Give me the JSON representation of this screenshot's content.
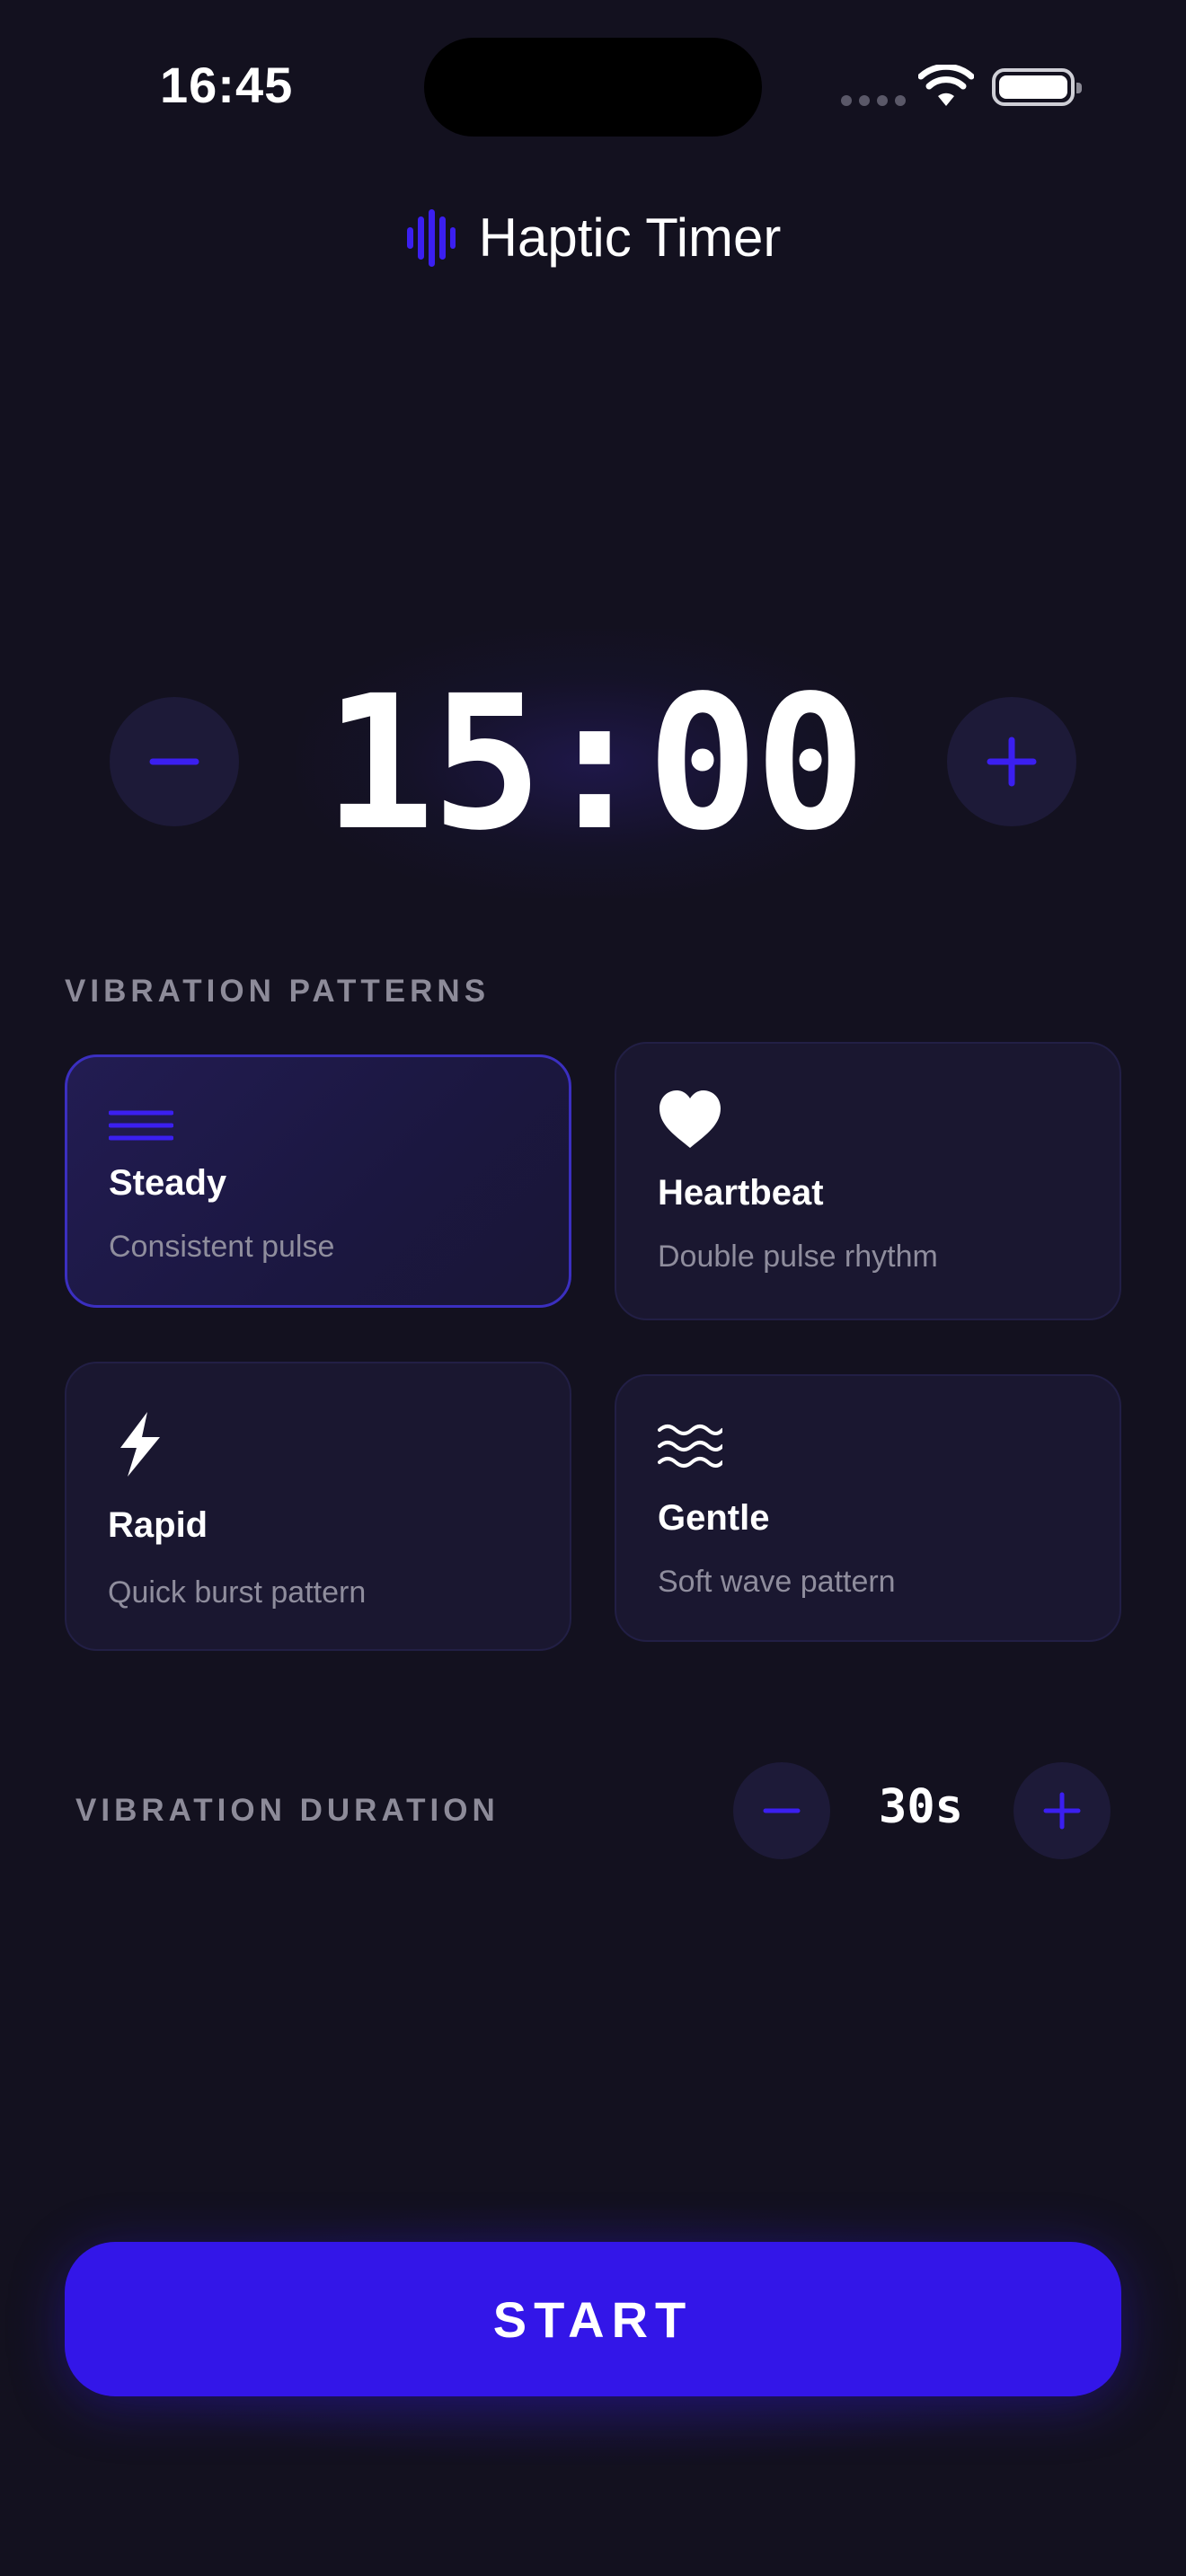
{
  "status_bar": {
    "time": "16:45"
  },
  "header": {
    "title": "Haptic Timer",
    "logo_icon": "waveform-icon",
    "accent": "#3b1ff0"
  },
  "timer": {
    "value": "15:00",
    "decrement_icon": "minus-icon",
    "increment_icon": "plus-icon"
  },
  "patterns": {
    "label": "VIBRATION PATTERNS",
    "selected": "Steady",
    "items": [
      {
        "title": "Steady",
        "description": "Consistent pulse",
        "icon": "lines-icon"
      },
      {
        "title": "Heartbeat",
        "description": "Double pulse rhythm",
        "icon": "heart-icon"
      },
      {
        "title": "Rapid",
        "description": "Quick burst pattern",
        "icon": "lightning-icon"
      },
      {
        "title": "Gentle",
        "description": "Soft wave pattern",
        "icon": "waves-icon"
      }
    ]
  },
  "duration": {
    "label": "VIBRATION DURATION",
    "value": "30s"
  },
  "start": {
    "label": "START",
    "color": "#3316e8"
  }
}
